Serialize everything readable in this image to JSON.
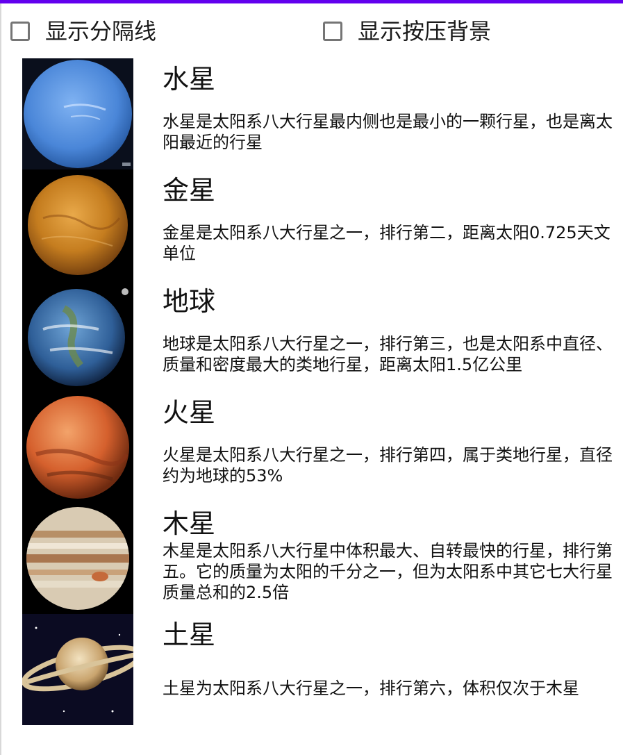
{
  "options": [
    {
      "label": "显示分隔线",
      "checked": false
    },
    {
      "label": "显示按压背景",
      "checked": false
    }
  ],
  "planets": [
    {
      "name": "水星",
      "description": "水星是太阳系八大行星最内侧也是最小的一颗行星，也是离太阳最近的行星",
      "image": "planet-neptune-like-blue"
    },
    {
      "name": "金星",
      "description": "金星是太阳系八大行星之一，排行第二，距离太阳0.725天文单位",
      "image": "planet-venus-orange"
    },
    {
      "name": "地球",
      "description": "地球是太阳系八大行星之一，排行第三，也是太阳系中直径、质量和密度最大的类地行星，距离太阳1.5亿公里",
      "image": "planet-earth"
    },
    {
      "name": "火星",
      "description": "火星是太阳系八大行星之一，排行第四，属于类地行星，直径约为地球的53%",
      "image": "planet-mars"
    },
    {
      "name": "木星",
      "description": "木星是太阳系八大行星中体积最大、自转最快的行星，排行第五。它的质量为太阳的千分之一，但为太阳系中其它七大行星质量总和的2.5倍",
      "image": "planet-jupiter"
    },
    {
      "name": "土星",
      "description": "土星为太阳系八大行星之一，排行第六，体积仅次于木星",
      "image": "planet-saturn"
    }
  ],
  "colors": {
    "accent": "#6200ee",
    "checkbox_border": "#757575"
  }
}
